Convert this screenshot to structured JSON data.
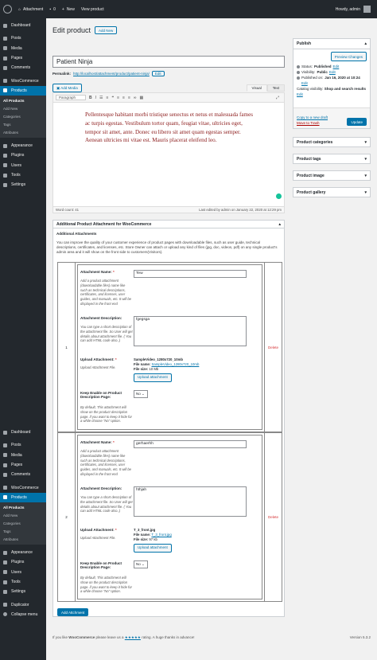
{
  "adminbar": {
    "site": "Attachment",
    "comments": "0",
    "new": "New",
    "view": "View product",
    "greeting": "Howdy, admin"
  },
  "sidebar_top": [
    {
      "label": "Dashboard",
      "icon": "dashboard-icon"
    },
    {
      "label": "Posts",
      "icon": "pin-icon"
    },
    {
      "label": "Media",
      "icon": "media-icon"
    },
    {
      "label": "Pages",
      "icon": "pages-icon"
    },
    {
      "label": "Comments",
      "icon": "comment-icon"
    },
    {
      "label": "WooCommerce",
      "icon": "woocommerce-icon"
    },
    {
      "label": "Products",
      "icon": "products-icon"
    }
  ],
  "products_sub": [
    "All Products",
    "Add New",
    "Categories",
    "Tags",
    "Attributes"
  ],
  "sidebar_mid": [
    {
      "label": "Appearance",
      "icon": "appearance-icon"
    },
    {
      "label": "Plugins",
      "icon": "plugins-icon"
    },
    {
      "label": "Users",
      "icon": "users-icon"
    },
    {
      "label": "Tools",
      "icon": "tools-icon"
    },
    {
      "label": "Settings",
      "icon": "settings-icon"
    }
  ],
  "sidebar_dup_top": [
    {
      "label": "Dashboard",
      "icon": "dashboard-icon"
    },
    {
      "label": "Posts",
      "icon": "pin-icon"
    },
    {
      "label": "Media",
      "icon": "media-icon"
    },
    {
      "label": "Pages",
      "icon": "pages-icon"
    },
    {
      "label": "Comments",
      "icon": "comment-icon"
    },
    {
      "label": "WooCommerce",
      "icon": "woocommerce-icon"
    },
    {
      "label": "Products",
      "icon": "products-icon"
    }
  ],
  "sidebar_dup_bottom": [
    {
      "label": "Appearance",
      "icon": "appearance-icon"
    },
    {
      "label": "Plugins",
      "icon": "plugins-icon"
    },
    {
      "label": "Users",
      "icon": "users-icon"
    },
    {
      "label": "Tools",
      "icon": "tools-icon"
    },
    {
      "label": "Settings",
      "icon": "settings-icon"
    },
    {
      "label": "Duplicator",
      "icon": "duplicator-icon"
    },
    {
      "label": "Collapse menu",
      "icon": "collapse-icon"
    }
  ],
  "page": {
    "heading": "Edit product",
    "add_new": "Add New",
    "title": "Patient Ninja",
    "permalink_label": "Permalink:",
    "permalink_url": "http://localhost/attachment/product/patient-ninja/",
    "edit": "Edit"
  },
  "editor": {
    "add_media": "Add Media",
    "tab_visual": "Visual",
    "tab_text": "Text",
    "format": "Paragraph",
    "content": "Pellentesque habitant morbi tristique senectus et netus et malesuada fames ac turpis egestas. Vestibulum tortor quam, feugiat vitae, ultricies eget, tempor sit amet, ante. Donec eu libero sit amet quam egestas semper. Aenean ultricies mi vitae est. Mauris placerat eleifend leo.",
    "word_count": "Word count: 41",
    "last_edited": "Last edited by admin on January 22, 2020 at 12:29 pm"
  },
  "attach_box": {
    "title": "Additional Product Attachment for WooCommerce",
    "subtitle": "Additional Attachments",
    "intro": "You can improve the quality of your customer experience of product pages with downloadable files, such as user guide, technical descriptions, certificates, and licenses, etc. Store Owner can attach or upload any kind of files (jpg, doc, videos, pdf) on any single product's admin area and it will show on the front side to customers(Visitors).",
    "name_label": "Attachment Name:",
    "name_help": "Add a product attachment (downloadable files) name like such as technical descriptions, certificates, and licenses, user guides, and manuals, etc. It will be displayed in the front end",
    "desc_label": "Attachment Description:",
    "desc_help": "You can type a short description of the attachment file. So User will get details about attachment file. ( You can add HTML code also..)",
    "upload_label": "Upload Attachment:",
    "upload_help": "Upload Attachment File.",
    "enable_label": "Keep Enable on Product Description Page:",
    "enable_help": "By default, This attachment will show on the product description page. if you want to keep it hide for a while choose \"No\" option.",
    "file_name_label": "File name:",
    "file_size_label": "File size:",
    "upload_btn": "Upload attachment",
    "delete": "Delete",
    "add_btn": "Add Attchment",
    "rows": [
      {
        "num": "1",
        "name": "Tew",
        "desc": "fgegsga",
        "file_title": "SampleVideo_1280x720_10mb",
        "file_name": "SampleVideo_1280x720_10mb",
        "file_size": "10 Mb",
        "enable": "No"
      },
      {
        "num": "2",
        "name": "gerhaerhh",
        "desc": "hthjah",
        "file_title": "T_3_front.jpg",
        "file_name": "T_3_front.jpg",
        "file_size": "97 kb",
        "enable": "No"
      }
    ]
  },
  "publish": {
    "title": "Publish",
    "preview": "Preview Changes",
    "status_label": "Status:",
    "status": "Published",
    "visibility_label": "Visibility:",
    "visibility": "Public",
    "published_label": "Published on:",
    "published": "Jan 16, 2020 at 10:24",
    "catalog_label": "Catalog visibility:",
    "catalog": "Shop and search results",
    "edit": "Edit",
    "copy_draft": "Copy to a new draft",
    "trash": "Move to Trash",
    "update": "Update"
  },
  "boxes": [
    "Product categories",
    "Product tags",
    "Product image",
    "Product gallery"
  ],
  "footer": {
    "left_pre": "If you like",
    "brand": "WooCommerce",
    "left_mid": "please leave us a",
    "stars": "★★★★★",
    "left_post": "rating. A huge thanks in advance!",
    "version": "Version 5.3.2"
  }
}
